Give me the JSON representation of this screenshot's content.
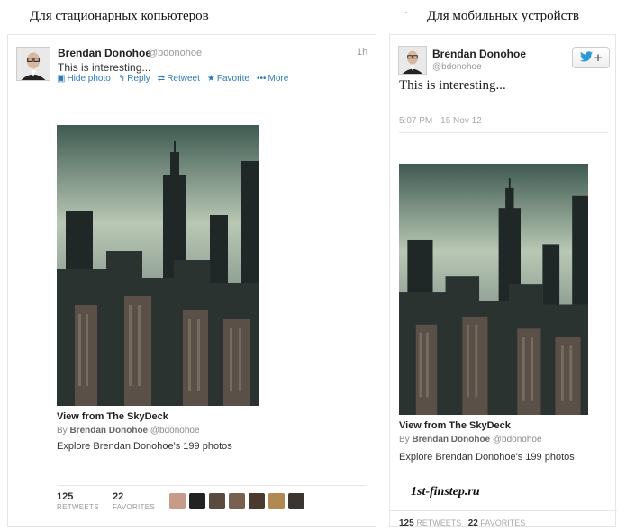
{
  "captions": {
    "desktop": "Для стационарных копьютеров",
    "dot": "˙",
    "mobile": "Для мобильных устройств"
  },
  "desktop": {
    "author_name": "Brendan Donohoe",
    "author_handle": "@bdonohoe",
    "time": "1h",
    "text": "This is interesting...",
    "actions": [
      {
        "icon": "image-icon",
        "glyph": "▣",
        "label": "Hide photo"
      },
      {
        "icon": "reply-icon",
        "glyph": "↰",
        "label": "Reply"
      },
      {
        "icon": "retweet-icon",
        "glyph": "⇄",
        "label": "Retweet"
      },
      {
        "icon": "favorite-star-icon",
        "glyph": "★",
        "label": "Favorite"
      },
      {
        "icon": "more-dots-icon",
        "glyph": "•••",
        "label": "More"
      }
    ],
    "photo": {
      "title": "View from The SkyDeck",
      "by_prefix": "By",
      "by_name": "Brendan Donohoe",
      "by_handle": "@bdonohoe",
      "explore": "Explore Brendan Donohoe's 199 photos"
    },
    "stats": {
      "retweets_count": "125",
      "retweets_label": "RETWEETS",
      "favorites_count": "22",
      "favorites_label": "FAVORITES"
    },
    "face_colors": [
      "#c89a8a",
      "#222222",
      "#5a4a40",
      "#7a6050",
      "#4a3a30",
      "#b08a50",
      "#3a3530"
    ]
  },
  "mobile": {
    "author_name": "Brendan Donohoe",
    "author_handle": "@bdonohoe",
    "text": "This is interesting...",
    "date": "5:07 PM · 15 Nov 12",
    "follow_icon": "twitter-bird-icon",
    "photo": {
      "title": "View from The SkyDeck",
      "by_prefix": "By",
      "by_name": "Brendan Donohoe",
      "by_handle": "@bdonohoe",
      "explore": "Explore Brendan Donohoe's 199 photos"
    },
    "stats": {
      "retweets_count": "125",
      "retweets_label": "RETWEETS",
      "favorites_count": "22",
      "favorites_label": "FAVORITES"
    }
  },
  "watermark": "1st-finstep.ru",
  "colors": {
    "link": "#2b7bb9",
    "twitter_blue": "#2b9ad8"
  }
}
